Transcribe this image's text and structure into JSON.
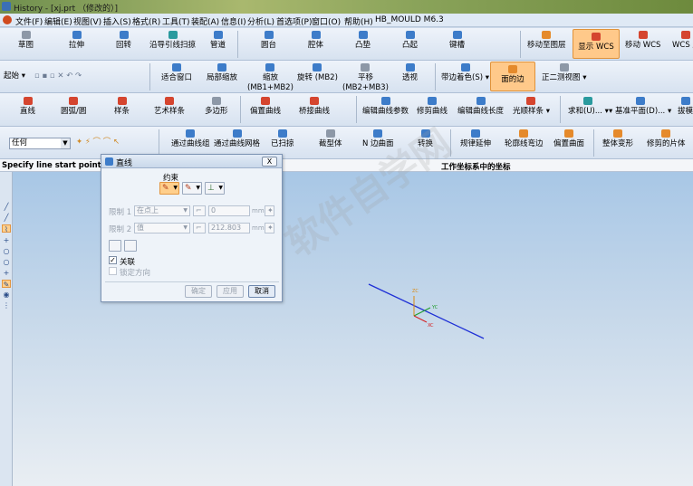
{
  "titlebar": {
    "title": "History - [xj.prt （修改的）]"
  },
  "menu": [
    "文件(F)",
    "编辑(E)",
    "视图(V)",
    "插入(S)",
    "格式(R)",
    "工具(T)",
    "装配(A)",
    "信息(I)",
    "分析(L)",
    "首选项(P)",
    "窗口(O)",
    "帮助(H)",
    "HB_MOULD M6.3"
  ],
  "row1": [
    "草图",
    "拉伸",
    "回转",
    "沿导引线扫掠",
    "管道",
    "圆台",
    "腔体",
    "凸垫",
    "凸起",
    "键槽",
    "移动至图层",
    "显示 WCS",
    "移动 WCS",
    "WCS 原"
  ],
  "row2": {
    "start": "起始",
    "items": [
      "适合窗口",
      "局部缩放",
      "缩放",
      "(MB1+MB2)",
      "旋转 (MB2)",
      "平移",
      "(MB2+MB3)",
      "透视",
      "带边着色(S)",
      "面的边",
      "正二测视图"
    ]
  },
  "row3": [
    "直线",
    "圆弧/圆",
    "样条",
    "艺术样条",
    "多边形",
    "偏置曲线",
    "桥接曲线",
    "编辑曲线参数",
    "修剪曲线",
    "编辑曲线长度",
    "光顺样条",
    "求和(U)...",
    "基准平面(D)...",
    "拔模"
  ],
  "row4": {
    "filter": "任何",
    "items": [
      "通过曲线组",
      "通过曲线网格",
      "已扫掠",
      "截型体",
      "N 边曲面",
      "转换",
      "规律延伸",
      "轮廓线弯边",
      "偏置曲面",
      "整体变形",
      "修剪的片体"
    ]
  },
  "status": {
    "prompt": "Specify line start point or de",
    "coord": "工作坐标系中的坐标"
  },
  "dialog": {
    "title": "直线",
    "close": "X",
    "constraint_label": "约束",
    "limit1_label": "限制 1",
    "limit1_select": "在点上",
    "limit1_value": "0",
    "limit2_label": "限制 2",
    "limit2_select": "值",
    "limit2_value": "212.803",
    "unit": "mm",
    "associative": "关联",
    "lock_direction": "锁定方向",
    "btn_ok": "确定",
    "btn_apply": "应用",
    "btn_cancel": "取消"
  },
  "watermark": "软件自学网",
  "colors": {
    "active_highlight": "#ffc98a",
    "line": "#1e2fd6",
    "axis_x": "#d52020",
    "axis_y": "#1f9d2a",
    "axis_z": "#d88a15"
  }
}
